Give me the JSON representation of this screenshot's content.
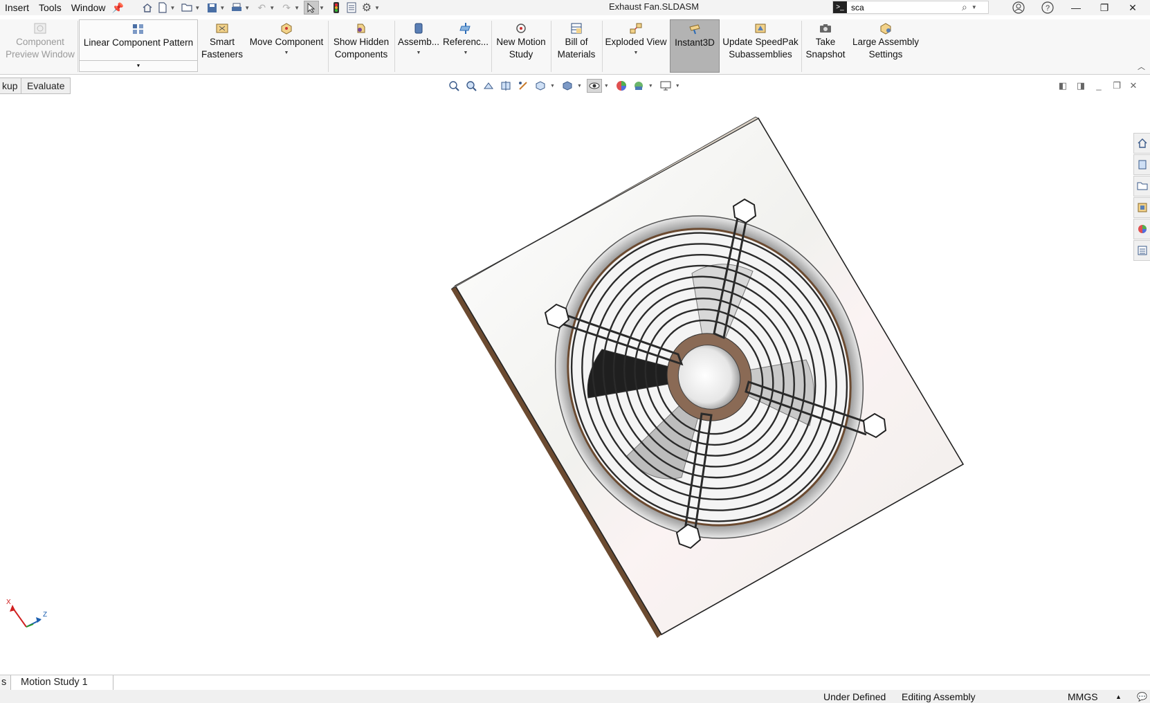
{
  "menu": [
    "Insert",
    "Tools",
    "Window"
  ],
  "document_title": "Exhaust Fan.SLDASM",
  "search": {
    "value": "sca"
  },
  "commands": {
    "component_preview": [
      "Component",
      "Preview Window"
    ],
    "linear_component_pattern": "Linear Component Pattern",
    "smart_fasteners": [
      "Smart",
      "Fasteners"
    ],
    "move_component": "Move Component",
    "show_hidden_components": [
      "Show Hidden",
      "Components"
    ],
    "assembly": "Assemb...",
    "reference": "Referenc...",
    "new_motion_study": [
      "New Motion",
      "Study"
    ],
    "bill_of_materials": [
      "Bill of",
      "Materials"
    ],
    "exploded_view": "Exploded View",
    "instant3d": "Instant3D",
    "update_speedpak": [
      "Update SpeedPak",
      "Subassemblies"
    ],
    "take_snapshot": [
      "Take",
      "Snapshot"
    ],
    "large_assembly_settings": [
      "Large Assembly",
      "Settings"
    ]
  },
  "command_tabs": [
    "kup",
    "Evaluate"
  ],
  "triad_labels": {
    "x": "X",
    "z": "Z"
  },
  "bottom_tabs": [
    "s",
    "Motion Study 1"
  ],
  "status": {
    "definition": "Under Defined",
    "mode": "Editing Assembly",
    "units": "MMGS"
  },
  "colors": {
    "accent_blue": "#1c5fb0",
    "plate_edge": "#6b4a30",
    "guard_wire": "#2a2a2a"
  }
}
